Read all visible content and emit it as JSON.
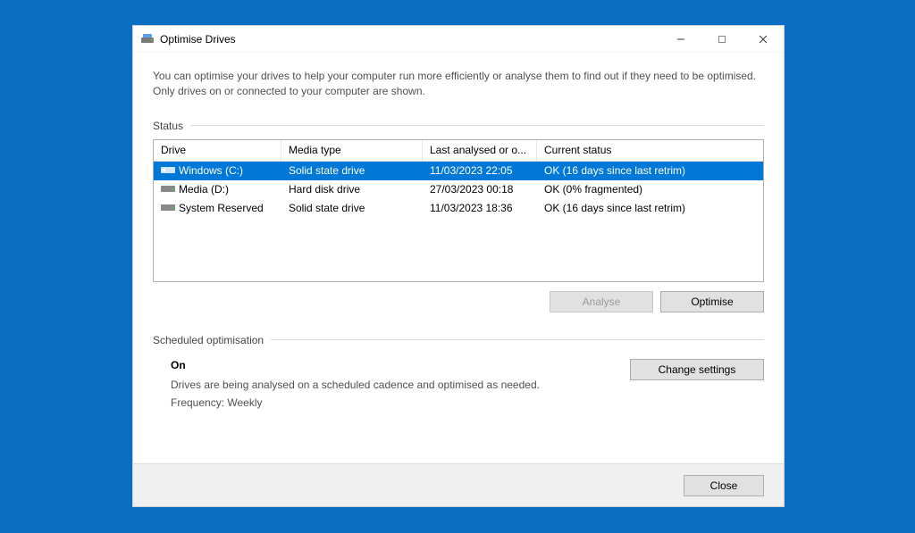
{
  "window": {
    "title": "Optimise Drives"
  },
  "description": "You can optimise your drives to help your computer run more efficiently or analyse them to find out if they need to be optimised. Only drives on or connected to your computer are shown.",
  "status_group_label": "Status",
  "columns": {
    "drive": "Drive",
    "media": "Media type",
    "last": "Last analysed or o...",
    "status": "Current status"
  },
  "drives": [
    {
      "name": "Windows (C:)",
      "media": "Solid state drive",
      "last": "11/03/2023 22:05",
      "status": "OK (16 days since last retrim)",
      "icon": "ssd",
      "selected": true
    },
    {
      "name": "Media (D:)",
      "media": "Hard disk drive",
      "last": "27/03/2023 00:18",
      "status": "OK (0% fragmented)",
      "icon": "hdd",
      "selected": false
    },
    {
      "name": "System Reserved",
      "media": "Solid state drive",
      "last": "11/03/2023 18:36",
      "status": "OK (16 days since last retrim)",
      "icon": "hdd",
      "selected": false
    }
  ],
  "buttons": {
    "analyse": "Analyse",
    "optimise": "Optimise",
    "change_settings": "Change settings",
    "close": "Close"
  },
  "scheduled": {
    "group_label": "Scheduled optimisation",
    "on": "On",
    "desc": "Drives are being analysed on a scheduled cadence and optimised as needed.",
    "frequency": "Frequency: Weekly"
  }
}
